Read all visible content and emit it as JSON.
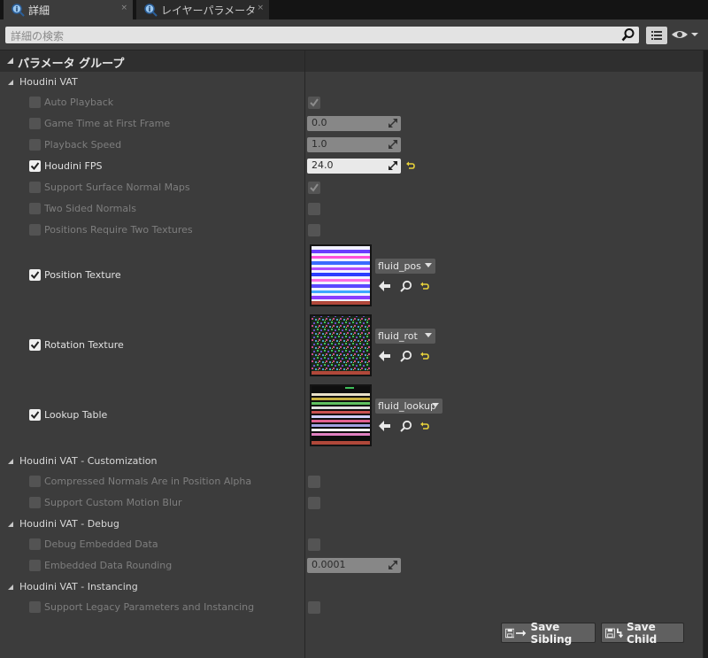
{
  "tabs": [
    {
      "label": "詳細",
      "active": true,
      "close": "×"
    },
    {
      "label": "レイヤーパラメータ",
      "active": false,
      "close": "×"
    }
  ],
  "search": {
    "placeholder": "詳細の検索"
  },
  "group_header": "パラメータ グループ",
  "sections": [
    {
      "title": "Houdini VAT"
    },
    {
      "title": "Houdini VAT - Customization"
    },
    {
      "title": "Houdini VAT - Debug"
    },
    {
      "title": "Houdini VAT - Instancing"
    }
  ],
  "params": {
    "auto_playback": {
      "label": "Auto Playback",
      "override": false,
      "value_checked": true
    },
    "game_time": {
      "label": "Game Time at First Frame",
      "override": false,
      "value": "0.0"
    },
    "playback_speed": {
      "label": "Playback Speed",
      "override": false,
      "value": "1.0"
    },
    "houdini_fps": {
      "label": "Houdini FPS",
      "override": true,
      "value": "24.0"
    },
    "surface_normal": {
      "label": "Support Surface Normal Maps",
      "override": false,
      "value_checked": true
    },
    "two_sided": {
      "label": "Two Sided Normals",
      "override": false,
      "value_checked": false
    },
    "two_textures": {
      "label": "Positions Require Two Textures",
      "override": false,
      "value_checked": false
    },
    "position_texture": {
      "label": "Position Texture",
      "override": true,
      "asset": "fluid_pos"
    },
    "rotation_texture": {
      "label": "Rotation Texture",
      "override": true,
      "asset": "fluid_rot"
    },
    "lookup_table": {
      "label": "Lookup Table",
      "override": true,
      "asset": "fluid_lookup"
    },
    "compressed_normals": {
      "label": "Compressed Normals Are in Position Alpha",
      "override": false,
      "value_checked": false
    },
    "motion_blur": {
      "label": "Support Custom Motion Blur",
      "override": false,
      "value_checked": false
    },
    "debug_embedded": {
      "label": "Debug Embedded Data",
      "override": false,
      "value_checked": false
    },
    "embedded_rounding": {
      "label": "Embedded Data Rounding",
      "override": false,
      "value": "0.0001"
    },
    "legacy": {
      "label": "Support Legacy Parameters and Instancing",
      "override": false,
      "value_checked": false
    }
  },
  "buttons": {
    "save_sibling": "Save Sibling",
    "save_child": "Save Child"
  },
  "colors": {
    "reset_arrow": "#e8d23a",
    "bg": "#3c3c3c"
  }
}
